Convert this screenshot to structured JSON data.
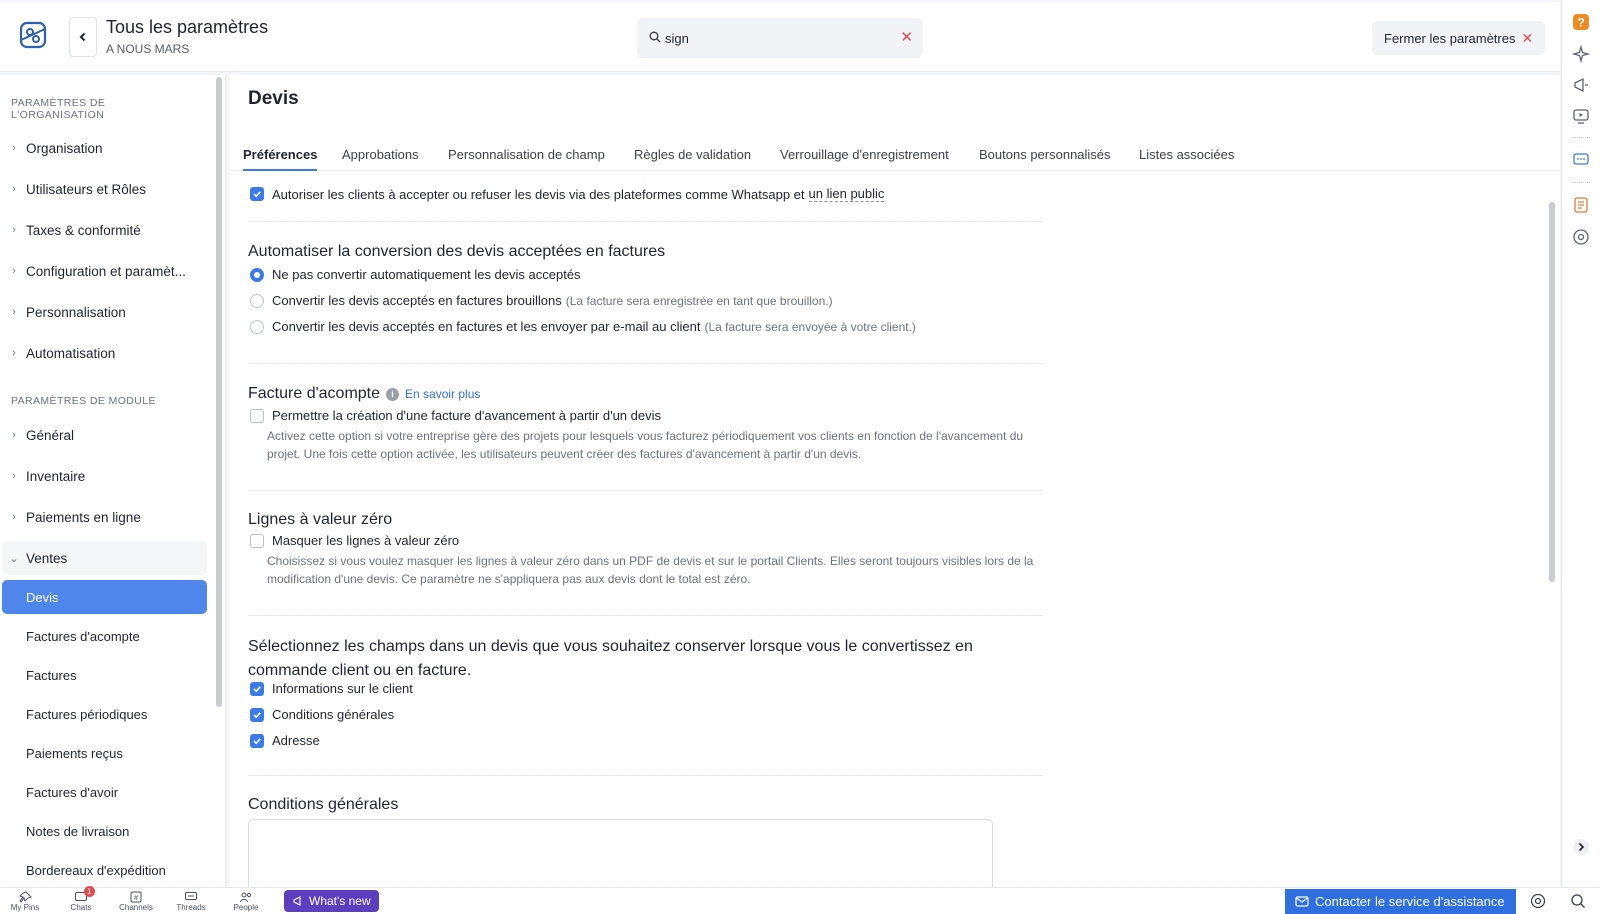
{
  "header": {
    "title": "Tous les paramètres",
    "org": "A NOUS MARS",
    "search_value": "sign",
    "close_label": "Fermer les paramètres"
  },
  "sidebar": {
    "org_heading": "PARAMÈTRES DE L'ORGANISATION",
    "org_items": [
      {
        "label": "Organisation"
      },
      {
        "label": "Utilisateurs et Rôles"
      },
      {
        "label": "Taxes & conformité"
      },
      {
        "label": "Configuration et paramèt..."
      },
      {
        "label": "Personnalisation"
      },
      {
        "label": "Automatisation"
      }
    ],
    "module_heading": "PARAMÈTRES DE MODULE",
    "module_items": [
      {
        "label": "Général"
      },
      {
        "label": "Inventaire"
      },
      {
        "label": "Paiements en ligne"
      },
      {
        "label": "Ventes"
      }
    ],
    "sales_subitems": [
      {
        "label": "Devis"
      },
      {
        "label": "Factures d'acompte"
      },
      {
        "label": "Factures"
      },
      {
        "label": "Factures périodiques"
      },
      {
        "label": "Paiements reçus"
      },
      {
        "label": "Factures d'avoir"
      },
      {
        "label": "Notes de livraison"
      },
      {
        "label": "Bordereaux d'expédition"
      }
    ]
  },
  "main": {
    "title": "Devis",
    "tabs": [
      {
        "label": "Préférences"
      },
      {
        "label": "Approbations"
      },
      {
        "label": "Personnalisation de champ"
      },
      {
        "label": "Règles de validation"
      },
      {
        "label": "Verrouillage d'enregistrement"
      },
      {
        "label": "Boutons personnalisés"
      },
      {
        "label": "Listes associées"
      }
    ],
    "allow_clients": {
      "label": "Autoriser les clients à accepter ou refuser les devis via des plateformes comme Whatsapp et",
      "link": "un lien public",
      "checked": true
    },
    "auto_convert": {
      "title": "Automatiser la conversion des devis acceptées en factures",
      "options": [
        {
          "label": "Ne pas convertir automatiquement les devis acceptés",
          "hint": "",
          "selected": true
        },
        {
          "label": "Convertir les devis acceptés en factures brouillons",
          "hint": "(La facture sera enregistrée en tant que brouillon.)",
          "selected": false
        },
        {
          "label": "Convertir les devis acceptés en factures et les envoyer par e-mail au client",
          "hint": "(La facture sera envoyée à votre client.)",
          "selected": false
        }
      ]
    },
    "advance_invoice": {
      "title": "Facture d'acompte",
      "learn_more": "En savoir plus",
      "option": "Permettre la création d'une facture d'avancement à partir d'un devis",
      "desc_line1": "Activez cette option si votre entreprise gère des projets pour lesquels vous facturez périodiquement vos clients en fonction de l'avancement du",
      "desc_line2": "projet. Une fois cette option activée, les utilisateurs peuvent créer des factures d'avancement à partir d'un devis.",
      "checked": false
    },
    "zero_lines": {
      "title": "Lignes à valeur zéro",
      "option": "Masquer les lignes à valeur zéro",
      "desc_line1": "Choisissez si vous voulez masquer les lignes à valeur zéro dans un PDF de devis et sur le portail Clients. Elles seront toujours visibles lors de la",
      "desc_line2": "modification d'une devis. Ce paramètre ne s'appliquera pas aux devis dont le total est zéro.",
      "checked": false
    },
    "retain_fields": {
      "title_line1": "Sélectionnez les champs dans un devis que vous souhaitez conserver lorsque vous le convertissez en",
      "title_line2": "commande client ou en facture.",
      "options": [
        {
          "label": "Informations sur le client",
          "checked": true
        },
        {
          "label": "Conditions générales",
          "checked": true
        },
        {
          "label": "Adresse",
          "checked": true
        }
      ]
    },
    "terms": {
      "title": "Conditions générales"
    }
  },
  "bottombar": {
    "items": [
      {
        "label": "My Pins"
      },
      {
        "label": "Chats",
        "badge": "1"
      },
      {
        "label": "Channels"
      },
      {
        "label": "Threads"
      },
      {
        "label": "People"
      }
    ],
    "whats_new": "What's new",
    "contact": "Contacter le service d'assistance"
  },
  "colors": {
    "accent": "#3b7be9",
    "active_nav": "#4f86ec",
    "danger": "#e5484d",
    "whats_new": "#5b3fbf"
  }
}
